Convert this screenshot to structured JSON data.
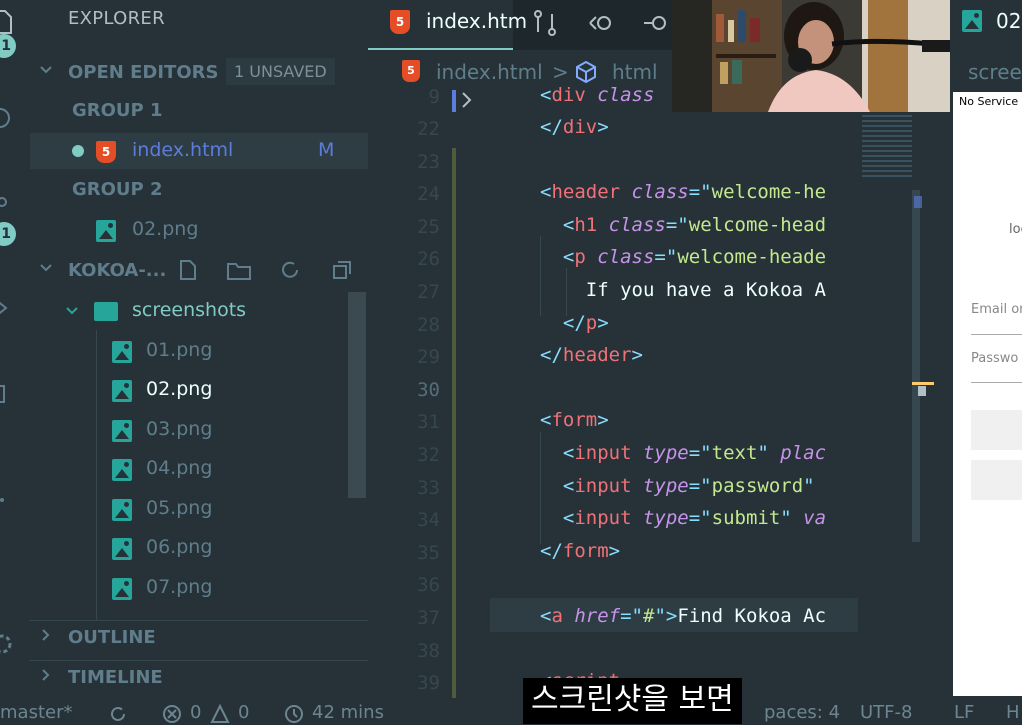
{
  "activity_bar": {
    "badges": [
      "1",
      "1"
    ],
    "icons": [
      "files-icon",
      "search-icon",
      "source-control-icon",
      "run-debug-icon",
      "extensions-icon",
      "more-icon",
      "settings-gear-icon"
    ]
  },
  "sidebar": {
    "title": "EXPLORER",
    "open_editors": {
      "label": "OPEN EDITORS",
      "badge": "1 UNSAVED",
      "groups": [
        {
          "label": "GROUP 1",
          "files": [
            {
              "name": "index.html",
              "status": "M",
              "icon": "html5-icon",
              "dirty": true
            }
          ]
        },
        {
          "label": "GROUP 2",
          "files": [
            {
              "name": "02.png",
              "icon": "image-icon"
            }
          ]
        }
      ]
    },
    "project": {
      "label": "KOKOA-...",
      "actions": [
        "new-file-icon",
        "new-folder-icon",
        "refresh-icon",
        "collapse-all-icon"
      ],
      "folder": "screenshots",
      "files": [
        "01.png",
        "02.png",
        "03.png",
        "04.png",
        "05.png",
        "06.png",
        "07.png"
      ]
    },
    "outline_label": "OUTLINE",
    "timeline_label": "TIMELINE"
  },
  "editor": {
    "tab_label": "index.htm",
    "tab2_label": "02",
    "breadcrumb": {
      "file": "index.html",
      "sep": ">",
      "node": "html"
    },
    "gutter_top": "9",
    "lines": [
      {
        "n": "22",
        "tokens": [
          [
            "pu",
            "</"
          ],
          [
            "tg",
            "div"
          ],
          [
            "pu",
            ">"
          ]
        ]
      },
      {
        "n": "23",
        "tokens": []
      },
      {
        "n": "24",
        "tokens": [
          [
            "pu",
            "<"
          ],
          [
            "tg",
            "header"
          ],
          [
            "at",
            " class"
          ],
          [
            "pu",
            "=\""
          ],
          [
            "st",
            "welcome-he"
          ]
        ]
      },
      {
        "n": "25",
        "tokens": [
          [
            "pu",
            "  <"
          ],
          [
            "tg",
            "h1"
          ],
          [
            "at",
            " class"
          ],
          [
            "pu",
            "=\""
          ],
          [
            "st",
            "welcome-head"
          ]
        ]
      },
      {
        "n": "26",
        "tokens": [
          [
            "pu",
            "  <"
          ],
          [
            "tg",
            "p"
          ],
          [
            "at",
            " class"
          ],
          [
            "pu",
            "=\""
          ],
          [
            "st",
            "welcome-heade"
          ]
        ]
      },
      {
        "n": "27",
        "tokens": [
          [
            "tx",
            "    If you have a Kokoa A"
          ]
        ]
      },
      {
        "n": "28",
        "tokens": [
          [
            "pu",
            "  </"
          ],
          [
            "tg",
            "p"
          ],
          [
            "pu",
            ">"
          ]
        ]
      },
      {
        "n": "29",
        "tokens": [
          [
            "pu",
            "</"
          ],
          [
            "tg",
            "header"
          ],
          [
            "pu",
            ">"
          ]
        ]
      },
      {
        "n": "30",
        "tokens": []
      },
      {
        "n": "31",
        "tokens": [
          [
            "pu",
            "<"
          ],
          [
            "tg",
            "form"
          ],
          [
            "pu",
            ">"
          ]
        ]
      },
      {
        "n": "32",
        "tokens": [
          [
            "pu",
            "  <"
          ],
          [
            "tg",
            "input"
          ],
          [
            "at",
            " type"
          ],
          [
            "pu",
            "=\""
          ],
          [
            "st",
            "text"
          ],
          [
            "pu",
            "\""
          ],
          [
            "at",
            " plac"
          ]
        ]
      },
      {
        "n": "33",
        "tokens": [
          [
            "pu",
            "  <"
          ],
          [
            "tg",
            "input"
          ],
          [
            "at",
            " type"
          ],
          [
            "pu",
            "=\""
          ],
          [
            "st",
            "password"
          ],
          [
            "pu",
            "\""
          ]
        ]
      },
      {
        "n": "34",
        "tokens": [
          [
            "pu",
            "  <"
          ],
          [
            "tg",
            "input"
          ],
          [
            "at",
            " type"
          ],
          [
            "pu",
            "=\""
          ],
          [
            "st",
            "submit"
          ],
          [
            "pu",
            "\""
          ],
          [
            "at",
            " va"
          ]
        ]
      },
      {
        "n": "35",
        "tokens": [
          [
            "pu",
            "</"
          ],
          [
            "tg",
            "form"
          ],
          [
            "pu",
            ">"
          ]
        ]
      },
      {
        "n": "36",
        "tokens": []
      },
      {
        "n": "37",
        "tokens": [
          [
            "pu",
            "<"
          ],
          [
            "tg",
            "a"
          ],
          [
            "at",
            " href"
          ],
          [
            "pu",
            "=\""
          ],
          [
            "st",
            "#"
          ],
          [
            "pu",
            "\">"
          ],
          [
            "tx",
            "Find Kokoa Ac"
          ]
        ]
      },
      {
        "n": "38",
        "tokens": []
      },
      {
        "n": "39",
        "tokens": [
          [
            "pu",
            "<"
          ],
          [
            "tg",
            "script"
          ]
        ]
      }
    ],
    "first_line_tokens": [
      [
        "pu",
        "<"
      ],
      [
        "tg",
        "div"
      ],
      [
        "at",
        " class"
      ]
    ]
  },
  "right_panel": {
    "tab_label": "02",
    "breadcrumb": "scree",
    "preview": {
      "status_text": "No Service",
      "partial_text": "log",
      "email_placeholder": "Email or",
      "password_placeholder": "Passwo"
    }
  },
  "status_bar": {
    "branch": "master*",
    "errors": "0",
    "warnings": "0",
    "time": "42 mins",
    "spaces": "paces: 4",
    "encoding": "UTF-8",
    "eol": "LF",
    "lang": "H"
  },
  "caption": "스크린샷을 보면",
  "colors": {
    "bg": "#263238",
    "accent": "#80cbc4",
    "html5": "#e44d26",
    "image": "#26a69a"
  }
}
